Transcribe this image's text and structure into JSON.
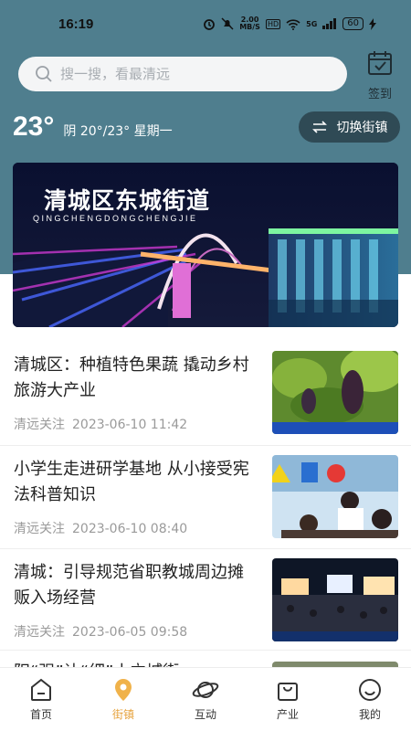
{
  "status_bar": {
    "time": "16:19",
    "speed": "2.00",
    "speed_unit": "MB/S",
    "hd": "HD",
    "signal": "5G",
    "battery": "60"
  },
  "search": {
    "placeholder": "搜一搜，看最清远"
  },
  "checkin": {
    "label": "签到"
  },
  "weather": {
    "temp": "23°",
    "desc": "阴 20°/23° 星期一"
  },
  "switch_town": {
    "label": "切换街镇"
  },
  "banner": {
    "title": "清城区东城街道",
    "subtitle": "QINGCHENGDONGCHENGJIE"
  },
  "news": [
    {
      "title": "清城区：种植特色果蔬 撬动乡村旅游大产业",
      "source": "清远关注",
      "time": "2023-06-10 11:42"
    },
    {
      "title": "小学生走进研学基地 从小接受宪法科普知识",
      "source": "清远关注",
      "time": "2023-06-10 08:40"
    },
    {
      "title": "清城：引导规范省职教城周边摊贩入场经营",
      "source": "清远关注",
      "time": "2023-06-05 09:58"
    },
    {
      "title": "阳“强”让“细”小立城街"
    }
  ],
  "tabs": [
    {
      "label": "首页",
      "icon": "home-icon"
    },
    {
      "label": "街镇",
      "icon": "location-pin-icon"
    },
    {
      "label": "互动",
      "icon": "planet-icon"
    },
    {
      "label": "产业",
      "icon": "shopping-bag-icon"
    },
    {
      "label": "我的",
      "icon": "smiley-icon"
    }
  ],
  "colors": {
    "header_bg": "#4f7e8e",
    "switch_bg": "#2f4a55",
    "active_tab": "#e6a23c"
  }
}
